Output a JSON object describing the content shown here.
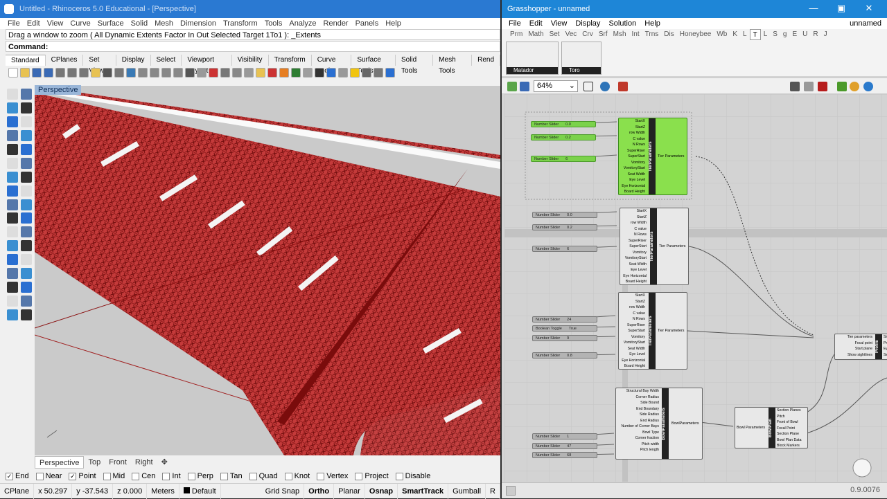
{
  "rhino": {
    "title": "Untitled - Rhinoceros 5.0 Educational - [Perspective]",
    "menu": [
      "File",
      "Edit",
      "View",
      "Curve",
      "Surface",
      "Solid",
      "Mesh",
      "Dimension",
      "Transform",
      "Tools",
      "Analyze",
      "Render",
      "Panels",
      "Help"
    ],
    "prompt": "Drag a window to zoom ( All  Dynamic  Extents  Factor  In  Out  Selected  Target  1To1 ): _Extents",
    "command_label": "Command:",
    "toolbar_tabs": [
      "Standard",
      "CPlanes",
      "Set View",
      "Display",
      "Select",
      "Viewport Layout",
      "Visibility",
      "Transform",
      "Curve Tools",
      "Surface Tools",
      "Solid Tools",
      "Mesh Tools",
      "Rend"
    ],
    "viewport_label": "Perspective",
    "viewport_tabs": [
      "Perspective",
      "Top",
      "Front",
      "Right"
    ],
    "osnap": [
      {
        "label": "End",
        "checked": true
      },
      {
        "label": "Near",
        "checked": false
      },
      {
        "label": "Point",
        "checked": true
      },
      {
        "label": "Mid",
        "checked": false
      },
      {
        "label": "Cen",
        "checked": false
      },
      {
        "label": "Int",
        "checked": false
      },
      {
        "label": "Perp",
        "checked": false
      },
      {
        "label": "Tan",
        "checked": false
      },
      {
        "label": "Quad",
        "checked": false
      },
      {
        "label": "Knot",
        "checked": false
      },
      {
        "label": "Vertex",
        "checked": false
      },
      {
        "label": "Project",
        "checked": false
      },
      {
        "label": "Disable",
        "checked": false
      }
    ],
    "status": {
      "cplane": "CPlane",
      "x": "x 50.297",
      "y": "y -37.543",
      "z": "z 0.000",
      "units": "Meters",
      "layer": "Default",
      "grid_snap": "Grid Snap",
      "ortho": "Ortho",
      "planar": "Planar",
      "osnap": "Osnap",
      "smarttrack": "SmartTrack",
      "gumball": "Gumball",
      "more": "R"
    },
    "colors": {
      "seating": "#b11f1f",
      "title": "#2a79d2"
    }
  },
  "gh": {
    "title": "Grasshopper - unnamed",
    "menu": [
      "File",
      "Edit",
      "View",
      "Display",
      "Solution",
      "Help"
    ],
    "doc_name": "unnamed",
    "tabs": [
      "Prm",
      "Math",
      "Set",
      "Vec",
      "Crv",
      "Srf",
      "Msh",
      "Int",
      "Trns",
      "Dis",
      "Honeybee",
      "Wb",
      "K",
      "L",
      "T",
      "L",
      "S",
      "g",
      "E",
      "U",
      "R",
      "J"
    ],
    "active_tab": "T",
    "panel_groups": [
      "Matador",
      "Toro"
    ],
    "zoom": "64%",
    "status_value": "0.9.0076",
    "tier_inputs": [
      "StartX",
      "StartZ",
      "row Width",
      "C value",
      "N Rows",
      "SuperRiser",
      "SuperStart",
      "Vomitory",
      "VomitoryStart",
      "Seat Width",
      "Eye Level",
      "Eye Horizontal",
      "Board Height"
    ],
    "tier_name": "TierParameters",
    "tier_output": "Tier Parameters",
    "sliders_a": [
      {
        "label": "Number Slider",
        "value": "0.0"
      },
      {
        "label": "Number Slider",
        "value": "0.2"
      },
      {
        "label": "Number Slider",
        "value": "6"
      }
    ],
    "sliders_b": [
      {
        "label": "Number Slider",
        "value": "0.0"
      },
      {
        "label": "Number Slider",
        "value": "0.2"
      },
      {
        "label": "Number Slider",
        "value": "6"
      }
    ],
    "sliders_c": [
      {
        "label": "Number Slider",
        "value": "24"
      },
      {
        "label": "Boolean Toggle",
        "value": "True"
      },
      {
        "label": "Number Slider",
        "value": "9"
      },
      {
        "label": "Number Slider",
        "value": "0.8"
      }
    ],
    "bowl_inputs": [
      "Structural Bay Width",
      "Corner Radius",
      "Side Bound",
      "End Boundary",
      "Side Radius",
      "End Radius",
      "Number of Corner Bays",
      "Bowl Type",
      "Corner fraction",
      "Pitch width",
      "Pitch length"
    ],
    "bowl_name": "BowlParameters",
    "bowl_output": "BowlParameters",
    "sliders_d": [
      {
        "label": "Number Slider",
        "value": "1"
      },
      {
        "label": "Number Slider",
        "value": "47"
      },
      {
        "label": "Number Slider",
        "value": "68"
      }
    ],
    "bowlplan_input": "Bowl Parameters",
    "bowlplan_name": "BowlPlan",
    "bowlplan_outputs": [
      "Section Planes",
      "Pitch",
      "Front of Bowl",
      "Focal Point",
      "Section Plane",
      "Bowl Plan Data",
      "Block Markers"
    ],
    "profile_inputs": [
      "Tier parameters",
      "Focal point",
      "Start plane",
      "Show sightlines"
    ],
    "profile_name": "Profile",
    "profile_outputs": [
      "Sigl",
      "Prof",
      "Eye",
      "Sect"
    ]
  }
}
